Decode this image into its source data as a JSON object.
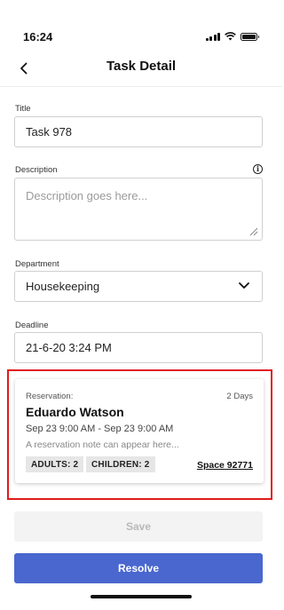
{
  "status_bar": {
    "time": "16:24",
    "icons": [
      "signal-icon",
      "wifi-icon",
      "battery-icon"
    ]
  },
  "nav": {
    "title": "Task Detail",
    "back_icon": "chevron-left-icon"
  },
  "form": {
    "title_label": "Title",
    "title_value": "Task 978",
    "description_label": "Description",
    "description_placeholder": "Description goes here...",
    "description_info_icon": "info-icon",
    "department_label": "Department",
    "department_value": "Housekeeping",
    "deadline_label": "Deadline",
    "deadline_value": "21-6-20 3:24 PM"
  },
  "reservation": {
    "label": "Reservation:",
    "duration": "2 Days",
    "guest_name": "Eduardo Watson",
    "dates": "Sep 23 9:00 AM - Sep 23 9:00 AM",
    "note": "A reservation note can appear here...",
    "adults": "ADULTS: 2",
    "children": "CHILDREN: 2",
    "space": "Space 92771",
    "highlight_color": "#e01b1b"
  },
  "actions": {
    "save_label": "Save",
    "resolve_label": "Resolve",
    "resolve_color": "#4a67cf"
  }
}
